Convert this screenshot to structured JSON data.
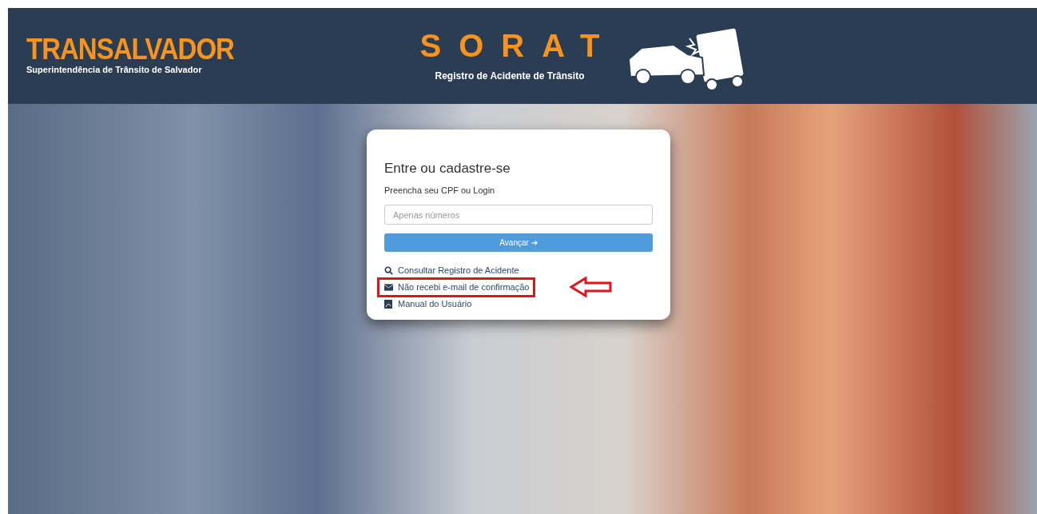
{
  "header": {
    "brand": "TRANSALVADOR",
    "brand_subtitle": "Superintendência de Trânsito de Salvador",
    "app_title": "SORAT",
    "app_subtitle": "Registro de Acidente de Trânsito"
  },
  "login": {
    "title": "Entre ou cadastre-se",
    "subtitle": "Preencha seu CPF ou Login",
    "field": {
      "placeholder": "Apenas números"
    },
    "button": "Avançar ➔",
    "links": [
      {
        "kind": "search",
        "label": "Consultar Registro de Acidente",
        "highlighted": false
      },
      {
        "kind": "mail",
        "label": "Não recebi e-mail de confirmação",
        "highlighted": true
      },
      {
        "kind": "pdf",
        "label": "Manual do Usuário",
        "highlighted": false
      }
    ]
  }
}
